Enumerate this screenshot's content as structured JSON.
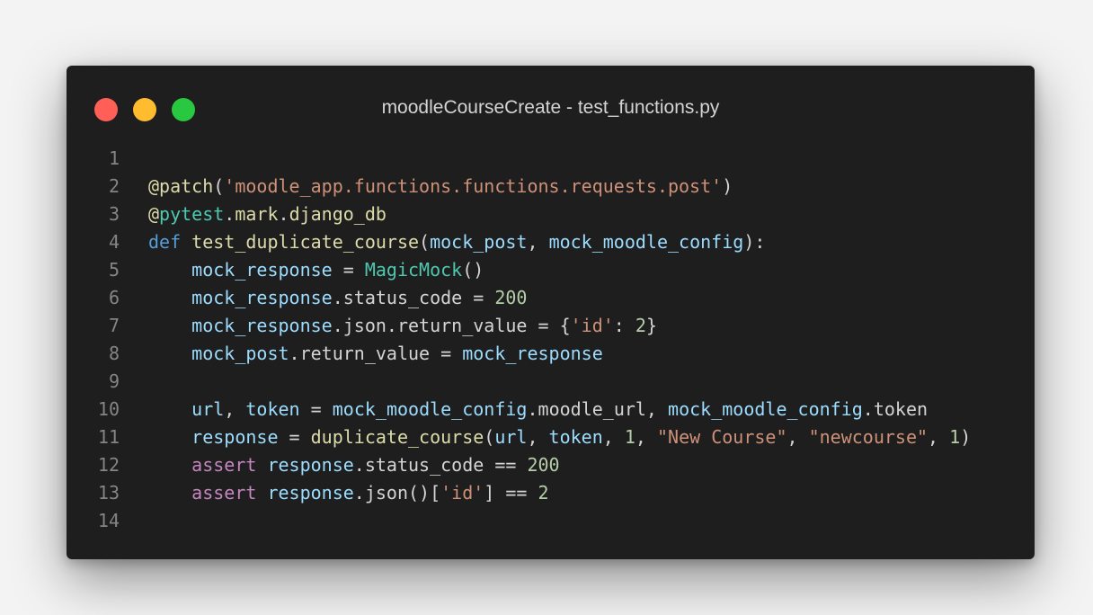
{
  "window": {
    "title": "moodleCourseCreate - test_functions.py",
    "traffic_lights": {
      "close": "#ff5f57",
      "minimize": "#febc2e",
      "zoom": "#28c840"
    }
  },
  "code": {
    "lines": [
      {
        "number": "1",
        "tokens": []
      },
      {
        "number": "2",
        "tokens": [
          {
            "text": "@patch",
            "kind": "decor"
          },
          {
            "text": "(",
            "kind": "punc"
          },
          {
            "text": "'moodle_app.functions.functions.requests.post'",
            "kind": "str"
          },
          {
            "text": ")",
            "kind": "punc"
          }
        ]
      },
      {
        "number": "3",
        "tokens": [
          {
            "text": "@",
            "kind": "decor"
          },
          {
            "text": "pytest",
            "kind": "cls"
          },
          {
            "text": ".",
            "kind": "punc"
          },
          {
            "text": "mark",
            "kind": "decor"
          },
          {
            "text": ".",
            "kind": "punc"
          },
          {
            "text": "django_db",
            "kind": "decor"
          }
        ]
      },
      {
        "number": "4",
        "tokens": [
          {
            "text": "def",
            "kind": "kw"
          },
          {
            "text": " ",
            "kind": "punc"
          },
          {
            "text": "test_duplicate_course",
            "kind": "fn"
          },
          {
            "text": "(",
            "kind": "punc"
          },
          {
            "text": "mock_post",
            "kind": "var"
          },
          {
            "text": ", ",
            "kind": "punc"
          },
          {
            "text": "mock_moodle_config",
            "kind": "var"
          },
          {
            "text": "):",
            "kind": "punc"
          }
        ]
      },
      {
        "number": "5",
        "tokens": [
          {
            "text": "    ",
            "kind": "punc"
          },
          {
            "text": "mock_response",
            "kind": "var"
          },
          {
            "text": " = ",
            "kind": "punc"
          },
          {
            "text": "MagicMock",
            "kind": "cls"
          },
          {
            "text": "()",
            "kind": "punc"
          }
        ]
      },
      {
        "number": "6",
        "tokens": [
          {
            "text": "    ",
            "kind": "punc"
          },
          {
            "text": "mock_response",
            "kind": "var"
          },
          {
            "text": ".status_code = ",
            "kind": "punc"
          },
          {
            "text": "200",
            "kind": "num"
          }
        ]
      },
      {
        "number": "7",
        "tokens": [
          {
            "text": "    ",
            "kind": "punc"
          },
          {
            "text": "mock_response",
            "kind": "var"
          },
          {
            "text": ".json.return_value = {",
            "kind": "punc"
          },
          {
            "text": "'id'",
            "kind": "str"
          },
          {
            "text": ": ",
            "kind": "punc"
          },
          {
            "text": "2",
            "kind": "num"
          },
          {
            "text": "}",
            "kind": "punc"
          }
        ]
      },
      {
        "number": "8",
        "tokens": [
          {
            "text": "    ",
            "kind": "punc"
          },
          {
            "text": "mock_post",
            "kind": "var"
          },
          {
            "text": ".return_value = ",
            "kind": "punc"
          },
          {
            "text": "mock_response",
            "kind": "var"
          }
        ]
      },
      {
        "number": "9",
        "tokens": []
      },
      {
        "number": "10",
        "tokens": [
          {
            "text": "    ",
            "kind": "punc"
          },
          {
            "text": "url",
            "kind": "var"
          },
          {
            "text": ", ",
            "kind": "punc"
          },
          {
            "text": "token",
            "kind": "var"
          },
          {
            "text": " = ",
            "kind": "punc"
          },
          {
            "text": "mock_moodle_config",
            "kind": "var"
          },
          {
            "text": ".moodle_url, ",
            "kind": "punc"
          },
          {
            "text": "mock_moodle_config",
            "kind": "var"
          },
          {
            "text": ".token",
            "kind": "punc"
          }
        ]
      },
      {
        "number": "11",
        "tokens": [
          {
            "text": "    ",
            "kind": "punc"
          },
          {
            "text": "response",
            "kind": "var"
          },
          {
            "text": " = ",
            "kind": "punc"
          },
          {
            "text": "duplicate_course",
            "kind": "fn"
          },
          {
            "text": "(",
            "kind": "punc"
          },
          {
            "text": "url",
            "kind": "var"
          },
          {
            "text": ", ",
            "kind": "punc"
          },
          {
            "text": "token",
            "kind": "var"
          },
          {
            "text": ", ",
            "kind": "punc"
          },
          {
            "text": "1",
            "kind": "num"
          },
          {
            "text": ", ",
            "kind": "punc"
          },
          {
            "text": "\"New Course\"",
            "kind": "str"
          },
          {
            "text": ", ",
            "kind": "punc"
          },
          {
            "text": "\"newcourse\"",
            "kind": "str"
          },
          {
            "text": ", ",
            "kind": "punc"
          },
          {
            "text": "1",
            "kind": "num"
          },
          {
            "text": ")",
            "kind": "punc"
          }
        ]
      },
      {
        "number": "12",
        "tokens": [
          {
            "text": "    ",
            "kind": "punc"
          },
          {
            "text": "assert",
            "kind": "ctrl"
          },
          {
            "text": " ",
            "kind": "punc"
          },
          {
            "text": "response",
            "kind": "var"
          },
          {
            "text": ".status_code == ",
            "kind": "punc"
          },
          {
            "text": "200",
            "kind": "num"
          }
        ]
      },
      {
        "number": "13",
        "tokens": [
          {
            "text": "    ",
            "kind": "punc"
          },
          {
            "text": "assert",
            "kind": "ctrl"
          },
          {
            "text": " ",
            "kind": "punc"
          },
          {
            "text": "response",
            "kind": "var"
          },
          {
            "text": ".json()[",
            "kind": "punc"
          },
          {
            "text": "'id'",
            "kind": "str"
          },
          {
            "text": "] == ",
            "kind": "punc"
          },
          {
            "text": "2",
            "kind": "num"
          }
        ]
      },
      {
        "number": "14",
        "tokens": []
      }
    ]
  }
}
